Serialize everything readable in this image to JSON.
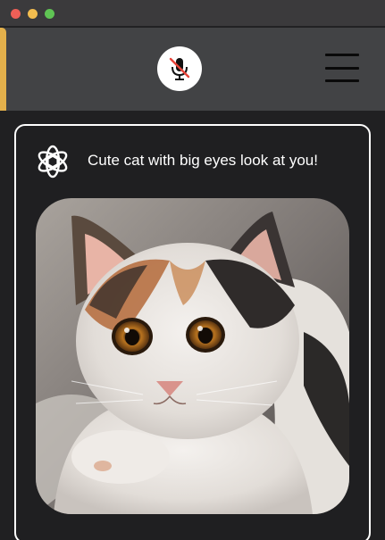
{
  "window": {
    "controls": [
      "close",
      "minimize",
      "maximize"
    ]
  },
  "toolbar": {
    "mic_icon": "microphone-muted-icon",
    "menu_icon": "hamburger-menu-icon"
  },
  "message": {
    "avatar_icon": "chatgpt-logo-icon",
    "text": "Cute cat with big eyes look at you!",
    "image": "generated-image-calico-kitten"
  },
  "colors": {
    "accent": "#e3b04b",
    "toolbar": "#424345",
    "background": "#202022",
    "card_border": "#ffffff"
  }
}
